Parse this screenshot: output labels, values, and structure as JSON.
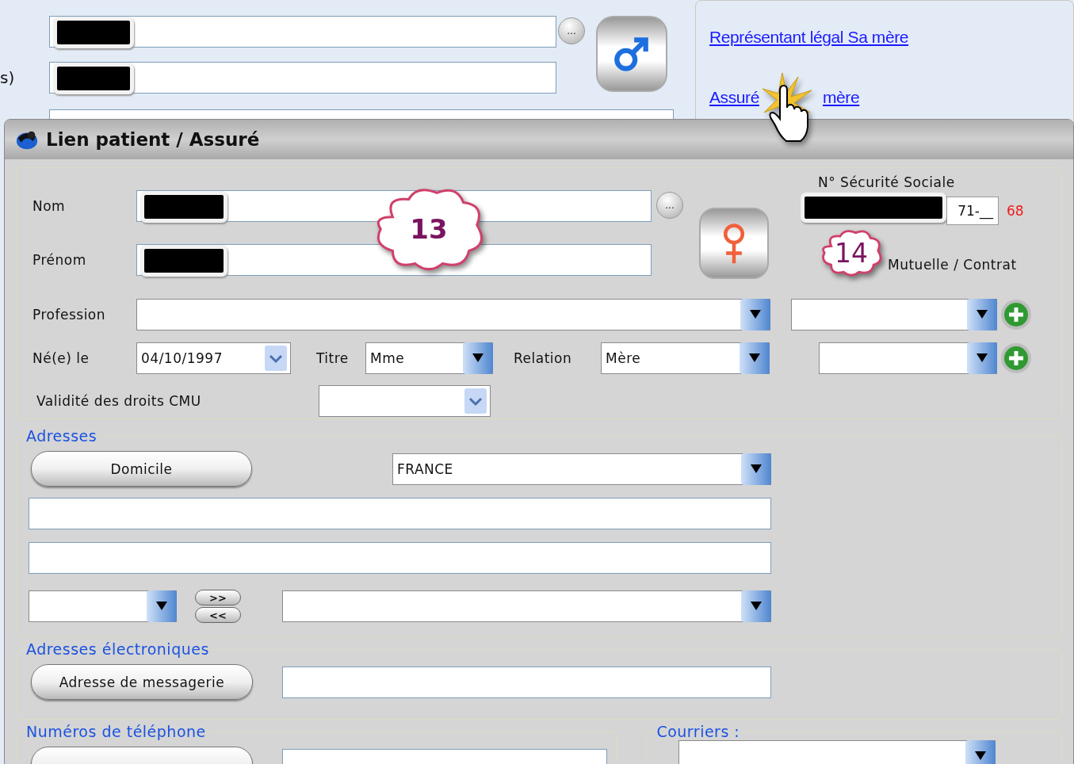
{
  "background_form": {
    "cut_label": "s)",
    "browse_button": "...",
    "links": [
      {
        "parts": [
          "Représentant légal Sa mère"
        ]
      },
      {
        "parts": [
          "Assuré",
          "mère"
        ]
      }
    ]
  },
  "dialog": {
    "title": "Lien patient / Assuré",
    "identity": {
      "nom_label": "Nom",
      "browse_button": "...",
      "prenom_label": "Prénom",
      "profession_label": "Profession",
      "birth_label": "Né(e) le",
      "birth_value": "04/10/1997",
      "titre_label": "Titre",
      "titre_value": "Mme",
      "relation_label": "Relation",
      "relation_value": "Mère",
      "cmu_label": "Validité des droits CMU",
      "ssn_label": "N° Sécurité Sociale",
      "ssn_value": "71-__",
      "ssn_key": "68",
      "mutuelle_label": "Mutuelle / Contrat"
    },
    "addresses": {
      "legend": "Adresses",
      "domicile_button": "Domicile",
      "country": "FRANCE",
      "swap_buttons": [
        ">>",
        "<<"
      ]
    },
    "email": {
      "legend": "Adresses électroniques",
      "button": "Adresse de messagerie"
    },
    "phone": {
      "legend": "Numéros de téléphone"
    },
    "courriers": {
      "legend": "Courriers :"
    }
  },
  "callouts": [
    "13",
    "14"
  ]
}
